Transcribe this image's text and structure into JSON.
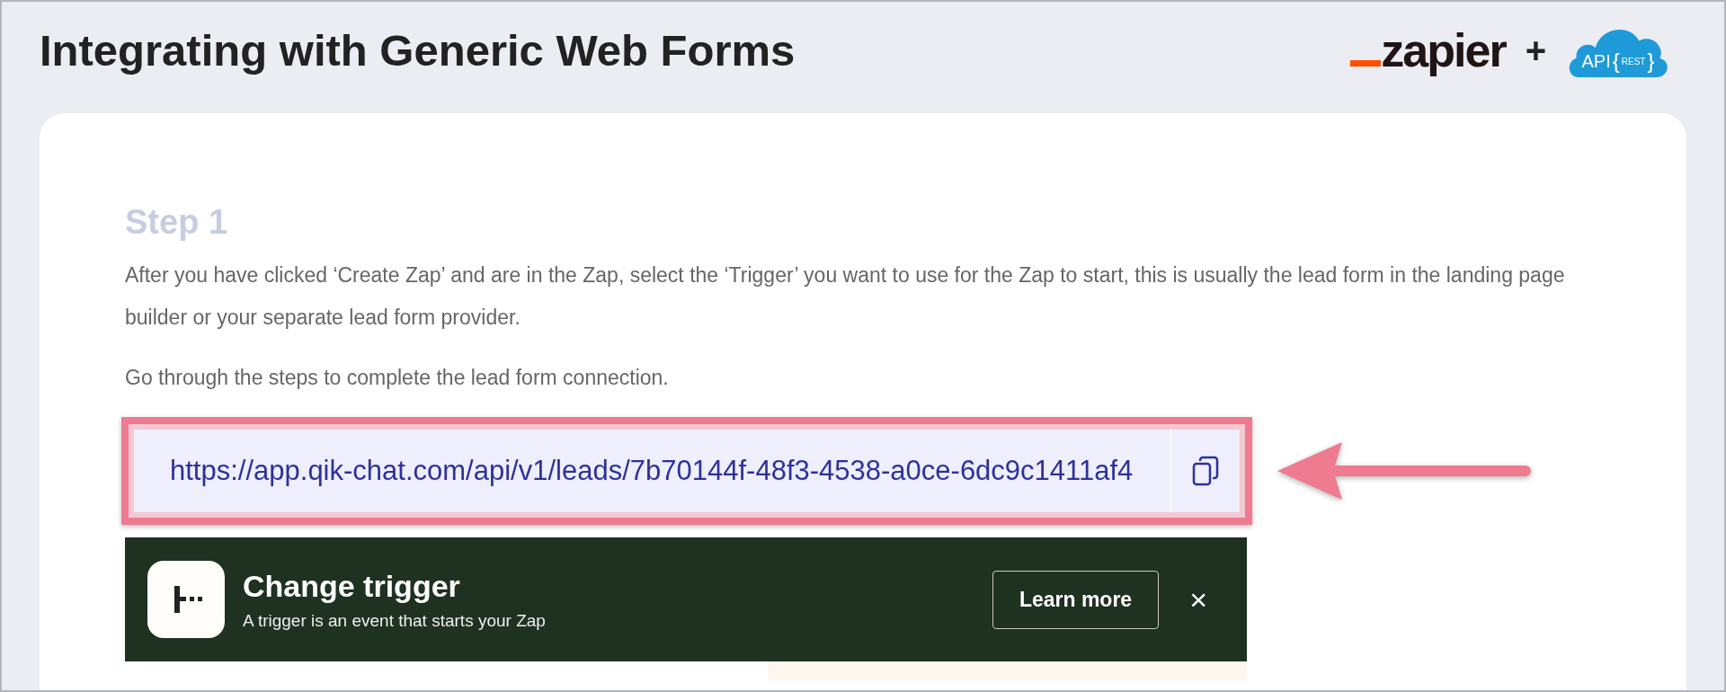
{
  "header": {
    "title": "Integrating with Generic Web Forms",
    "logo": {
      "brand": "zapier",
      "plus": "+",
      "cloud_texts": [
        "API",
        "{",
        "REST",
        "}"
      ]
    }
  },
  "step": {
    "heading": "Step 1",
    "paragraphs": [
      "After you have clicked ‘Create Zap’ and are in the Zap, select the ‘Trigger’ you want to use for the Zap to start, this is usually the lead form in the landing page builder or your separate lead form provider.",
      "Go through the steps to complete the lead form connection."
    ],
    "url_field": {
      "value": "https://app.qik-chat.com/api/v1/leads/7b70144f-48f3-4538-a0ce-6dc9c1411af4"
    },
    "banner": {
      "title": "Change trigger",
      "subtitle": "A trigger is an event that starts your Zap",
      "button": "Learn more",
      "close": "×"
    }
  }
}
